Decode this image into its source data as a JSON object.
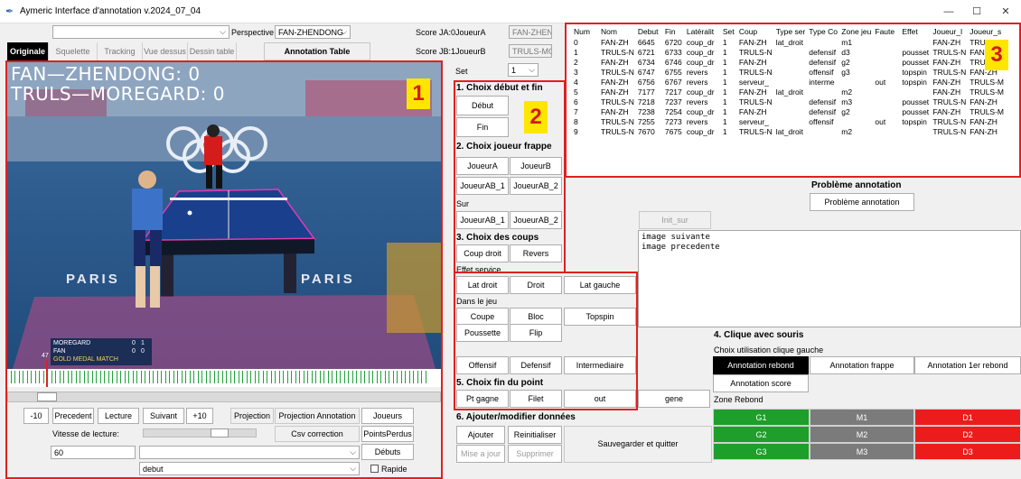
{
  "window": {
    "title": "Aymeric Interface d'annotation v.2024_07_04",
    "minimize": "—",
    "maximize": "☐",
    "close": "✕"
  },
  "top_left": {
    "combo_value": "",
    "perspective_label": "Perspective",
    "perspective_value": "FAN-ZHENDONG"
  },
  "tabs": [
    "Originale",
    "Squelette",
    "Tracking",
    "Vue dessus",
    "Dessin table"
  ],
  "annotation_table_button": "Annotation Table",
  "video": {
    "overlay_line1": "FAN—ZHENDONG: 0",
    "overlay_line2": "TRULS—MOREGARD: 0",
    "badge": "1",
    "paris_left": "PARIS",
    "paris_right": "PARIS",
    "scoreboard_p1": "MOREGARD",
    "scoreboard_p2": "FAN",
    "scoreboard_s1": "0",
    "scoreboard_s2": "1",
    "scoreboard_s3": "0",
    "scoreboard_s4": "0",
    "scoreboard_banner": "GOLD MEDAL MATCH",
    "timeline_marker": "47"
  },
  "transport": {
    "minus10": "-10",
    "precedent": "Precedent",
    "lecture": "Lecture",
    "suivant": "Suivant",
    "plus10": "+10",
    "projection": "Projection",
    "projection_annotation": "Projection Annotation",
    "joueurs": "Joueurs",
    "vitesse_label": "Vitesse de lecture:",
    "csv_correction": "Csv correction",
    "points_perdus": "PointsPerdus",
    "vitesse_value": "60",
    "debuts": "Débuts",
    "combo2_value": "",
    "combo3_value": "debut",
    "rapide": "Rapide"
  },
  "scores": {
    "ja_label": "Score JA:0",
    "ja_name": "JoueurA",
    "ja_value": "FAN-ZHENI",
    "jb_label": "Score JB:1",
    "jb_name": "JoueurB",
    "jb_value": "TRULS-MOI",
    "set_label": "Set",
    "set_value": "1"
  },
  "panel2": {
    "badge": "2",
    "s1": "1. Choix début et fin",
    "debut": "Début",
    "fin": "Fin",
    "s2": "2. Choix joueur frappe",
    "joueurA": "JoueurA",
    "joueurB": "JoueurB",
    "joueurAB1": "JoueurAB_1",
    "joueurAB2": "JoueurAB_2",
    "sur": "Sur",
    "sur_ab1": "JoueurAB_1",
    "sur_ab2": "JoueurAB_2",
    "s3": "3. Choix des coups",
    "coup_droit": "Coup droit",
    "revers": "Revers",
    "effet_service": "Effet service",
    "lat_droit": "Lat droit",
    "droit": "Droit",
    "lat_gauche": "Lat gauche",
    "dans_le_jeu": "Dans le jeu",
    "coupe": "Coupe",
    "bloc": "Bloc",
    "topspin": "Topspin",
    "poussette": "Poussette",
    "flip": "Flip",
    "offensif": "Offensif",
    "defensif": "Defensif",
    "intermediaire": "Intermediaire",
    "s5": "5. Choix fin du point",
    "pt_gagne": "Pt gagne",
    "filet": "Filet",
    "out": "out",
    "gene": "gene"
  },
  "table": {
    "badge": "3",
    "headers": [
      "Num",
      "Nom",
      "Debut",
      "Fin",
      "Latéralit",
      "Set",
      "Coup",
      "Type ser",
      "Type Co",
      "Zone jeu",
      "Faute",
      "Effet",
      "Joueur_l",
      "Joueur_s"
    ],
    "rows": [
      [
        "0",
        "FAN-ZH",
        "6645",
        "6720",
        "coup_dr",
        "1",
        "FAN-ZH",
        "lat_droit",
        "",
        "m1",
        "",
        "",
        "FAN-ZH",
        "TRULS-M"
      ],
      [
        "1",
        "TRULS-N",
        "6721",
        "6733",
        "coup_dr",
        "1",
        "TRULS-N",
        "",
        "defensif",
        "d3",
        "",
        "pousset",
        "TRULS-N",
        "FAN-ZH"
      ],
      [
        "2",
        "FAN-ZH",
        "6734",
        "6746",
        "coup_dr",
        "1",
        "FAN-ZH",
        "",
        "defensif",
        "g2",
        "",
        "pousset",
        "FAN-ZH",
        "TRULS-M"
      ],
      [
        "3",
        "TRULS-N",
        "6747",
        "6755",
        "revers",
        "1",
        "TRULS-N",
        "",
        "offensif",
        "g3",
        "",
        "topspin",
        "TRULS-N",
        "FAN-ZH"
      ],
      [
        "4",
        "FAN-ZH",
        "6756",
        "6767",
        "revers",
        "1",
        "serveur_",
        "",
        "interme",
        "",
        "out",
        "topspin",
        "FAN-ZH",
        "TRULS-M"
      ],
      [
        "5",
        "FAN-ZH",
        "7177",
        "7217",
        "coup_dr",
        "1",
        "FAN-ZH",
        "lat_droit",
        "",
        "m2",
        "",
        "",
        "FAN-ZH",
        "TRULS-M"
      ],
      [
        "6",
        "TRULS-N",
        "7218",
        "7237",
        "revers",
        "1",
        "TRULS-N",
        "",
        "defensif",
        "m3",
        "",
        "pousset",
        "TRULS-N",
        "FAN-ZH"
      ],
      [
        "7",
        "FAN-ZH",
        "7238",
        "7254",
        "coup_dr",
        "1",
        "FAN-ZH",
        "",
        "defensif",
        "g2",
        "",
        "pousset",
        "FAN-ZH",
        "TRULS-M"
      ],
      [
        "8",
        "TRULS-N",
        "7255",
        "7273",
        "revers",
        "1",
        "serveur_",
        "",
        "offensif",
        "",
        "out",
        "topspin",
        "TRULS-N",
        "FAN-ZH"
      ],
      [
        "9",
        "TRULS-N",
        "7670",
        "7675",
        "coup_dr",
        "1",
        "TRULS-N",
        "lat_droit",
        "",
        "m2",
        "",
        "",
        "TRULS-N",
        "FAN-ZH"
      ]
    ]
  },
  "probleme": {
    "title": "Problème annotation",
    "button": "Problème annotation"
  },
  "init_sur": "Init_sur",
  "log_text": [
    "image suivante",
    "image precedente"
  ],
  "section4": {
    "title": "4. Clique avec souris",
    "subtitle": "Choix utilisation clique gauche",
    "rebond": "Annotation rebond",
    "frappe": "Annotation frappe",
    "premier_rebond": "Annotation 1er rebond",
    "score": "Annotation score",
    "zone_rebond": "Zone Rebond"
  },
  "zones": [
    [
      "G1",
      "M1",
      "D1"
    ],
    [
      "G2",
      "M2",
      "D2"
    ],
    [
      "G3",
      "M3",
      "D3"
    ]
  ],
  "section6": {
    "title": "6. Ajouter/modifier données",
    "ajouter": "Ajouter",
    "reinitialiser": "Reinitialiser",
    "mise_a_jour": "Mise a jour",
    "supprimer": "Supprimer",
    "sauvegarder": "Sauvegarder et quitter"
  }
}
